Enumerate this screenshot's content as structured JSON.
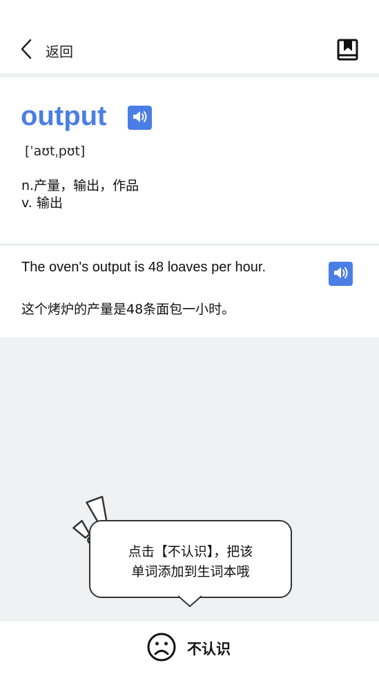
{
  "header": {
    "back_label": "返回",
    "back_icon": "chevron-left-icon",
    "bookmark_icon": "bookmark-book-icon"
  },
  "word": {
    "text": "output",
    "phonetic": "[ˈaʊtˌpʊt]",
    "definitions": [
      "n.产量，输出，作品",
      "v. 输出"
    ],
    "sound_icon": "speaker-icon"
  },
  "example": {
    "en": "The oven's output is 48 loaves per hour.",
    "zh": "这个烤炉的产量是48条面包一小时。",
    "sound_icon": "speaker-icon"
  },
  "tip": {
    "line1": "点击【不认识】，把该",
    "line2": "单词添加到生词本哦",
    "icon": "exclamation-icon"
  },
  "bottom": {
    "unknown_label": "不认识",
    "unknown_icon": "sad-face-icon"
  },
  "colors": {
    "accent": "#4a7ee6",
    "background": "#f0f1f3"
  }
}
